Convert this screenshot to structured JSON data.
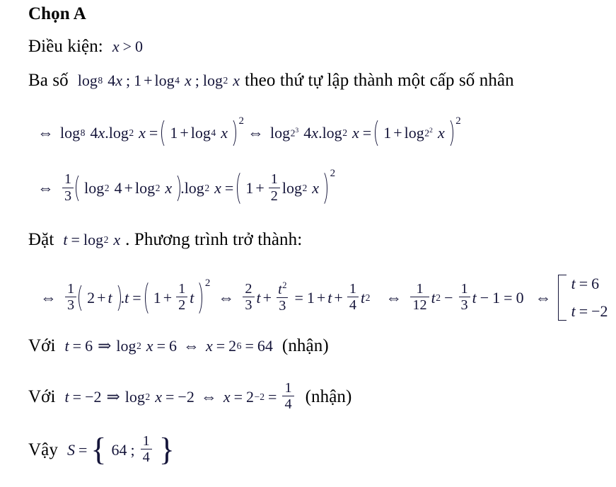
{
  "document": {
    "language": "vi",
    "heading": "Chọn A",
    "text_color": "#000000",
    "math_color": "#15153a",
    "background": "#ffffff"
  },
  "lines": {
    "condition_label": "Điều kiện:",
    "condition_math": "x > 0",
    "sequence_lead": "Ba số",
    "sequence_terms": "log₈ 4x ; 1 + log₄ x ; log₂ x",
    "sequence_tail": "theo thứ tự lập thành một cấp số nhân",
    "substitute_label": "Đặt",
    "substitute_math": "t = log₂ x",
    "substitute_tail": ". Phương trình trở thành:",
    "with_label": "Với",
    "case1_note": "(nhận)",
    "case2_note": "(nhận)",
    "conclusion_label": "Vậy"
  },
  "symbols": {
    "iff": "⇔",
    "implies": "⇒",
    "greater": ">",
    "equals": "=",
    "plus": "+",
    "minus": "−",
    "dot": ".",
    "semicolon": ";",
    "comma_sep": ";",
    "lparen": "(",
    "rparen": ")",
    "lbrace": "{",
    "rbrace": "}",
    "log": "log"
  },
  "eq1": {
    "log_base_a": "8",
    "arg_a": "4x",
    "log_base_b": "2",
    "arg_b": "x",
    "one": "1",
    "log_base_c": "4",
    "arg_c": "x",
    "power": "2",
    "log_base_a2_base": "2",
    "log_base_a2_exp": "3",
    "log_base_c2_base": "2",
    "log_base_c2_exp": "2"
  },
  "eq2": {
    "frac_num": "1",
    "frac_den": "3",
    "log2_of_4": "4",
    "var": "x",
    "base": "2",
    "one": "1",
    "half_num": "1",
    "half_den": "2",
    "power": "2"
  },
  "eq3": {
    "third_num": "1",
    "third_den": "3",
    "two": "2",
    "t": "t",
    "one": "1",
    "half_num": "1",
    "half_den": "2",
    "power": "2",
    "two_thirds_num": "2",
    "two_thirds_den": "3",
    "tsq_num": "t²",
    "tsq_den": "3",
    "rhs_one": "1",
    "quarter_num": "1",
    "quarter_den": "4",
    "tsq_exp": "2",
    "twelfth_num": "1",
    "twelfth_den": "12",
    "third2_num": "1",
    "third2_den": "3",
    "const": "1",
    "zero": "0"
  },
  "roots": {
    "root1": "t = 6",
    "root2": "t = −2",
    "root1_var": "t",
    "root1_val": "6",
    "root2_var": "t",
    "root2_val": "−2"
  },
  "case1": {
    "t_var": "t",
    "t_val": "6",
    "log_base": "2",
    "log_arg": "x",
    "log_val": "6",
    "x_var": "x",
    "pow_base": "2",
    "pow_exp": "6",
    "result": "64",
    "note": "(nhận)"
  },
  "case2": {
    "t_var": "t",
    "t_val": "−2",
    "log_base": "2",
    "log_arg": "x",
    "log_val": "−2",
    "x_var": "x",
    "pow_base": "2",
    "pow_exp": "−2",
    "result_num": "1",
    "result_den": "4",
    "note": "(nhận)"
  },
  "conclusion": {
    "label": "Vậy",
    "set_var": "S",
    "equals": "=",
    "member1": "64",
    "sep": ";",
    "member2_num": "1",
    "member2_den": "4"
  }
}
